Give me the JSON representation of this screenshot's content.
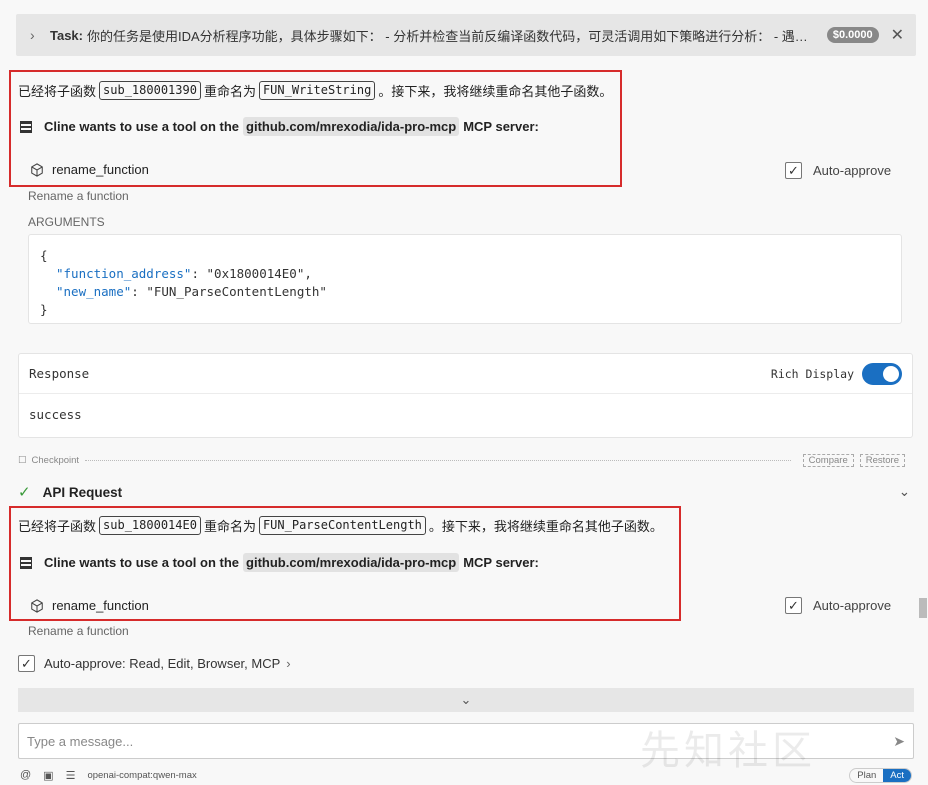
{
  "task": {
    "label": "Task:",
    "text": "你的任务是使用IDA分析程序功能，具体步骤如下： - 分析并检查当前反编译函数代码，可灵活调用如下策略进行分析： - 遇到...",
    "cost": "$0.0000"
  },
  "messages": [
    {
      "prefix": "已经将子函数",
      "old_name": "sub_180001390",
      "middle": "重命名为",
      "new_name": "FUN_WriteString",
      "suffix": "。接下来，我将继续重命名其他子函数。",
      "tool_prefix": "Cline wants to use a tool on the",
      "server": "github.com/mrexodia/ida-pro-mcp",
      "tool_suffix": "MCP server:",
      "function": "rename_function",
      "auto_approve": "Auto-approve",
      "description": "Rename a function"
    },
    {
      "prefix": "已经将子函数",
      "old_name": "sub_1800014E0",
      "middle": "重命名为",
      "new_name": "FUN_ParseContentLength",
      "suffix": "。接下来，我将继续重命名其他子函数。",
      "tool_prefix": "Cline wants to use a tool on the",
      "server": "github.com/mrexodia/ida-pro-mcp",
      "tool_suffix": "MCP server:",
      "function": "rename_function",
      "auto_approve": "Auto-approve",
      "description": "Rename a function"
    }
  ],
  "arguments": {
    "label": "ARGUMENTS",
    "open": "{",
    "close": "}",
    "lines": [
      {
        "key": "\"function_address\"",
        "value": ": \"0x1800014E0\","
      },
      {
        "key": "\"new_name\"",
        "value": ": \"FUN_ParseContentLength\""
      }
    ]
  },
  "response": {
    "title": "Response",
    "rich_display": "Rich Display",
    "rich_display_on": true,
    "body": "success"
  },
  "checkpoint": {
    "label": "Checkpoint",
    "compare": "Compare",
    "restore": "Restore"
  },
  "api_request": {
    "label": "API Request"
  },
  "auto_approve_settings": {
    "label": "Auto-approve: Read, Edit, Browser, MCP"
  },
  "input": {
    "placeholder": "Type a message..."
  },
  "footer": {
    "model": "openai-compat:qwen-max",
    "plan": "Plan",
    "act": "Act"
  },
  "watermark": "先知社区",
  "colors": {
    "accent": "#1a6fc2",
    "highlight_border": "#d62b2b",
    "success": "#3a9a3a"
  }
}
